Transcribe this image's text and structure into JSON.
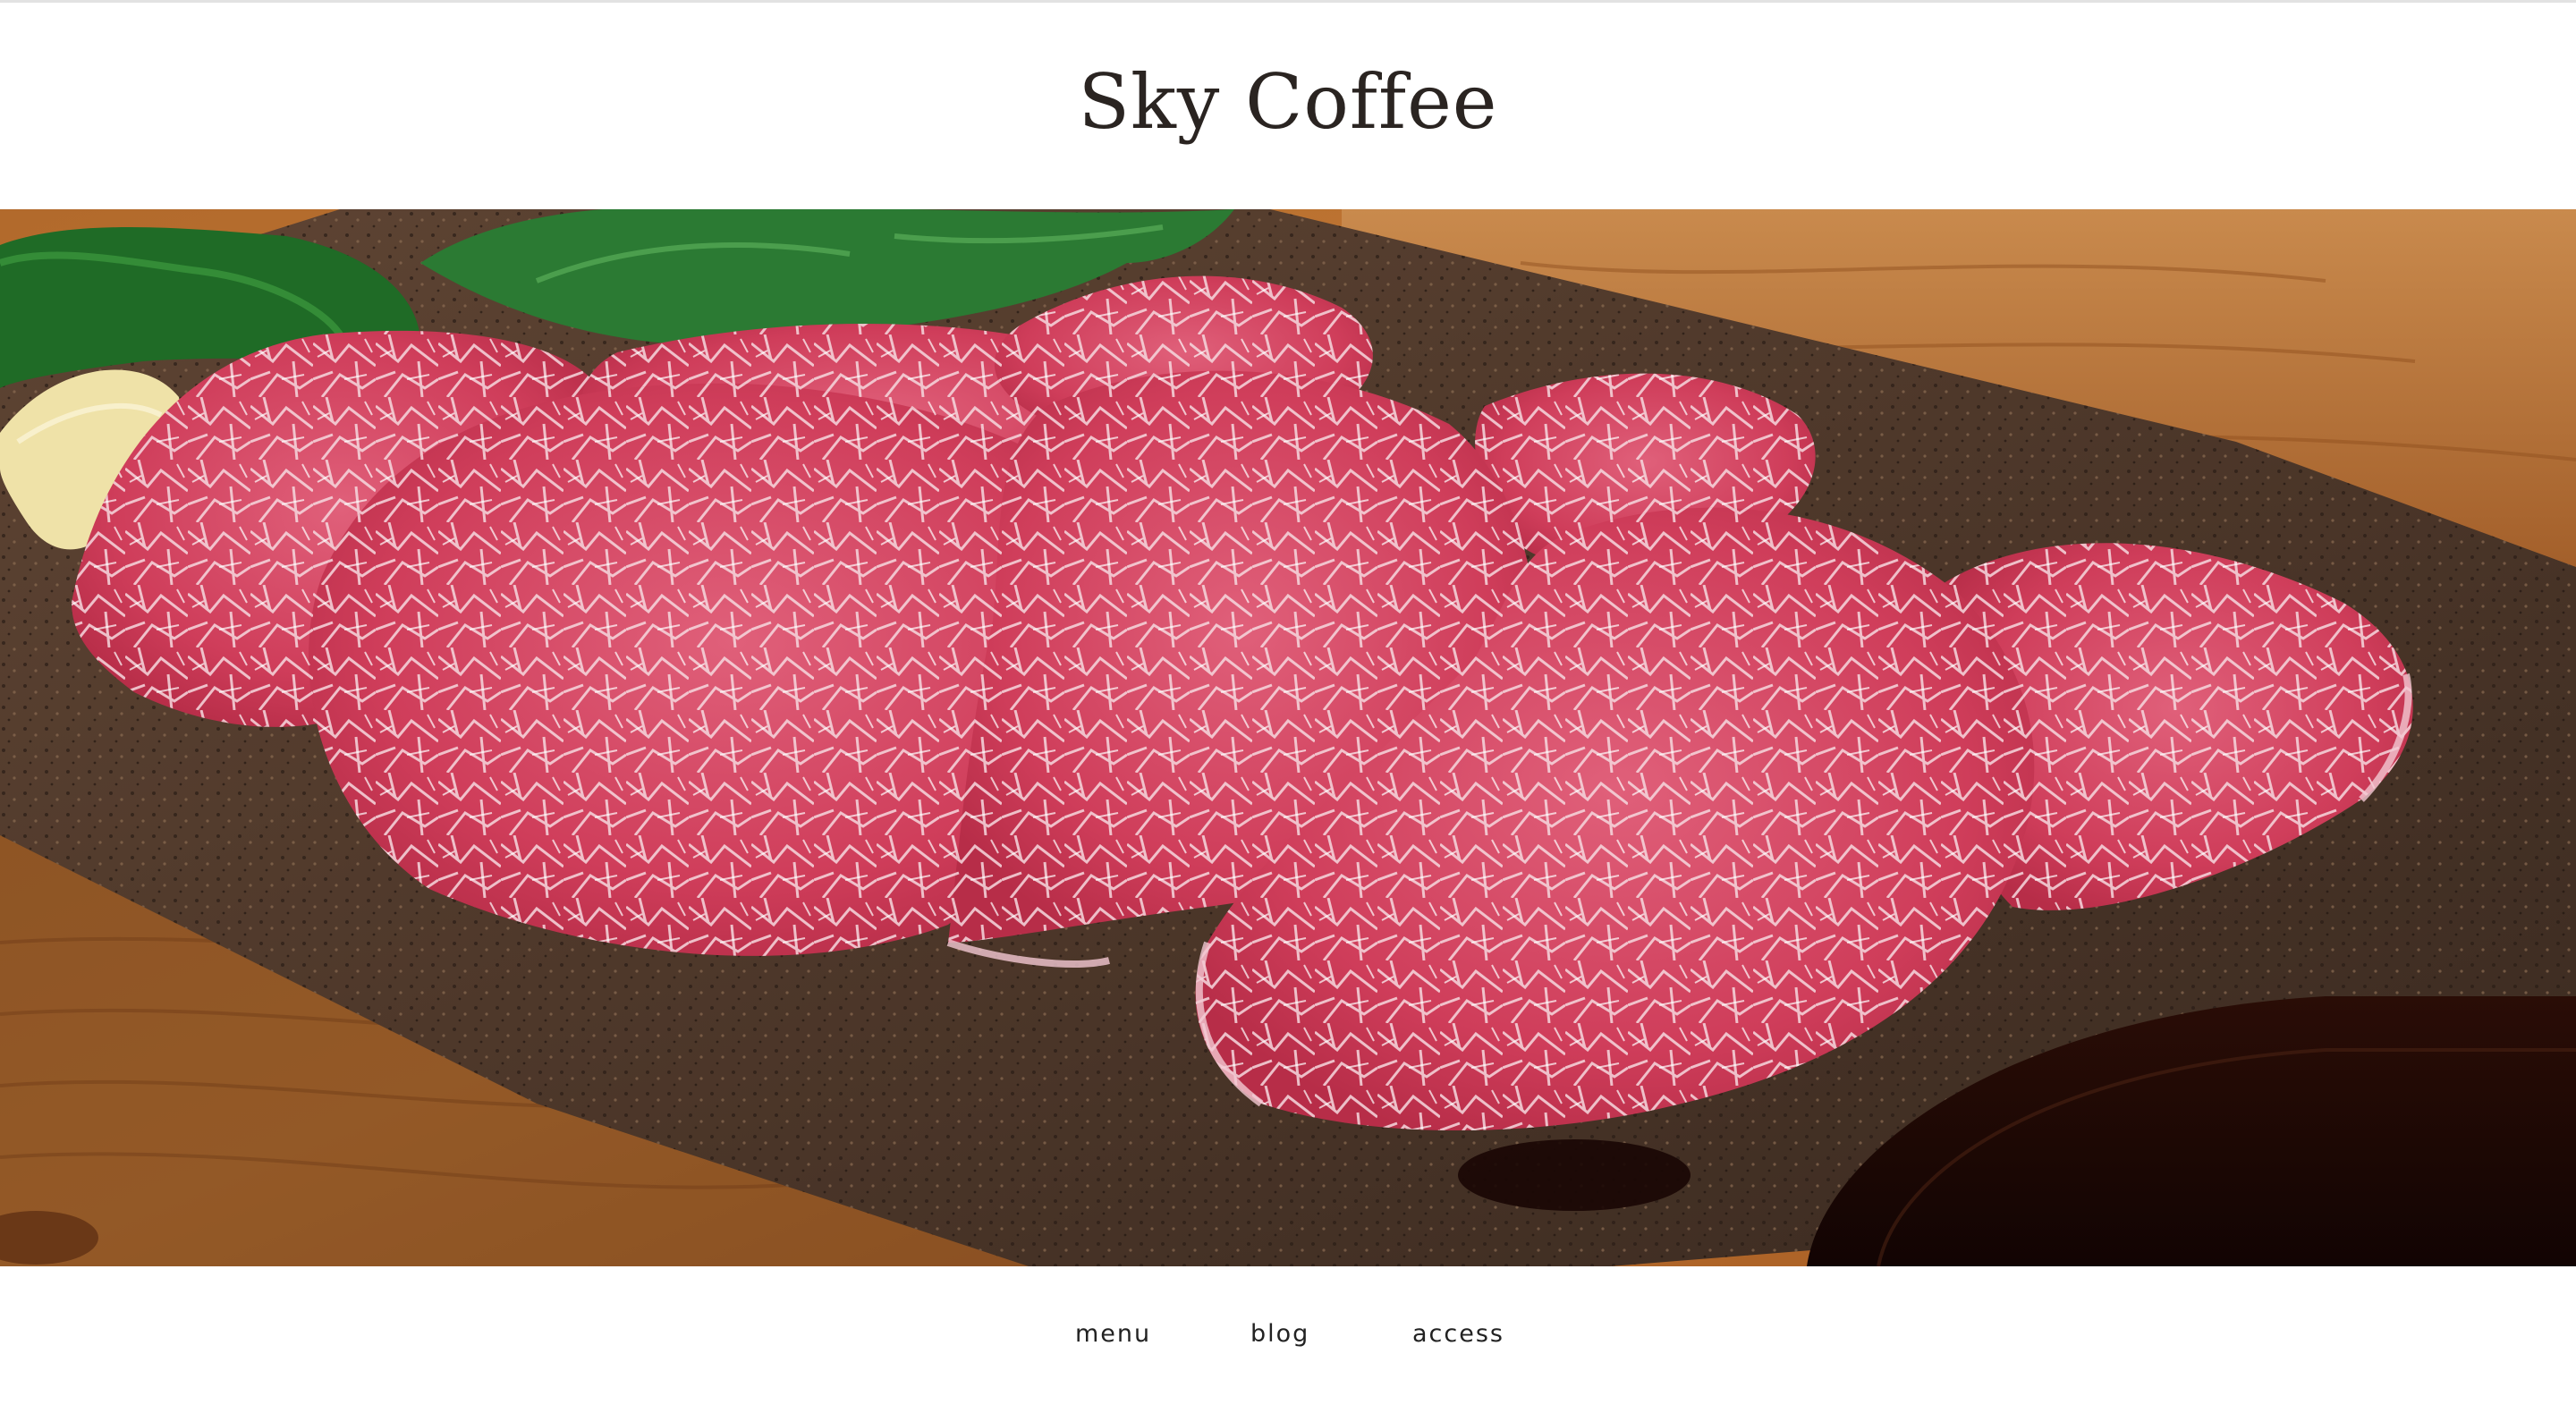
{
  "site": {
    "title": "Sky Coffee"
  },
  "hero": {
    "image_alt": "Plate of marbled raw beef slices on a stoneware dish"
  },
  "nav": {
    "items": [
      {
        "label": "menu"
      },
      {
        "label": "blog"
      },
      {
        "label": "access"
      }
    ]
  },
  "colors": {
    "title_text": "#2a2421",
    "nav_text": "#222222",
    "background": "#ffffff"
  }
}
